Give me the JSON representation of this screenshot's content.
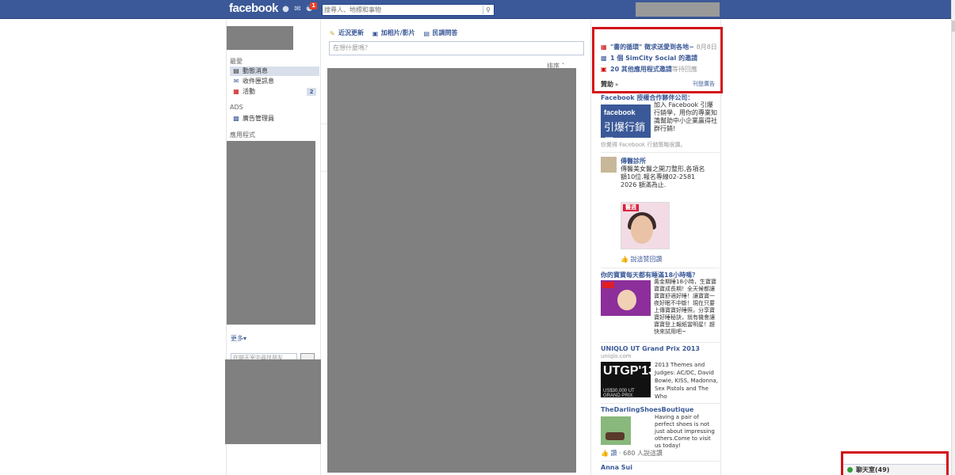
{
  "header": {
    "logo": "facebook",
    "notification_count": "1",
    "search_placeholder": "搜尋人、地標和事物",
    "search_icon": "magnifier-icon"
  },
  "left_nav": {
    "favorites_header": "最愛",
    "favorites": [
      {
        "label": "動態消息",
        "icon": "news-feed-icon"
      },
      {
        "label": "收件匣訊息",
        "icon": "messages-icon"
      },
      {
        "label": "活動",
        "icon": "events-icon",
        "count": "2"
      }
    ],
    "ads_header": "ADS",
    "ads": [
      {
        "label": "廣告管理員",
        "icon": "ads-manager-icon"
      }
    ],
    "apps_header": "應用程式",
    "more_link": "更多",
    "chat_search_placeholder": "在聊天室中尋找朋友"
  },
  "composer": {
    "tabs": [
      {
        "label": "近況更新",
        "icon": "status-icon"
      },
      {
        "label": "加相片/影片",
        "icon": "photo-icon"
      },
      {
        "label": "民調問答",
        "icon": "question-icon"
      }
    ],
    "placeholder": "在想什麼嗎？",
    "sort_label": "排序"
  },
  "requests": [
    {
      "text": "\"書的循環\" 徵求送愛到各地~",
      "date": "8月8日",
      "icon": "event-icon"
    },
    {
      "text": "1 個 SimCity Social 的邀請",
      "date": "",
      "icon": "game-icon"
    },
    {
      "text": "20 其他應用程式邀請",
      "date": "等待回應",
      "icon": "app-icon"
    }
  ],
  "sponsored": {
    "header": "贊助",
    "create_ad": "刊登廣告",
    "ads": [
      {
        "title": "Facebook 授權合作夥伴公司：",
        "body": "加入 Facebook 引爆行銷學，用你的專業知識幫助中小企業贏得社群行銷!",
        "image_text_a": "facebook",
        "image_text_b": "引爆行銷學",
        "like_text": "你覺得 Facebook 行銷策略很讚。"
      },
      {
        "title": "傳醫診所",
        "body": "傳醫美女醫之開刀整形,各項名額10位.報名專線02-2581 2026 額滿為止.",
        "image_text": "醫週",
        "like_text": "說這赞回讚"
      },
      {
        "title": "你的寶寶每天都有睡滿18小時嗎？",
        "body": "黃金期睡18小時，生寶寶寶寶成長期！全天候都讓寶寶舒適好睡！讓寶寶一夜好眠不中斷！現在只要上傳寶寶好睡照，分享寶寶好睡秘訣，就有機會讓寶寶登上報紙當明星！趕快來試用吧~"
      },
      {
        "title": "UNIQLO UT Grand Prix 2013",
        "subtitle": "uniqlo.com",
        "body": "2013 Themes and Judges: AC/DC, David Bowie, KISS, Madonna, Sex Pistols and The Who",
        "image_text": "UTGP'13",
        "image_sub": "US$30,000 UT GRAND PRIX"
      },
      {
        "title": "TheDarlingShoesBoutique",
        "body": "Having a pair of perfect shoes is not just about impressing others.Come to visit us today!",
        "like_text": "讚",
        "like_count": "680 人說這讚"
      },
      {
        "title": "Anna Sui"
      }
    ]
  },
  "chat": {
    "label": "聊天室(49)"
  }
}
